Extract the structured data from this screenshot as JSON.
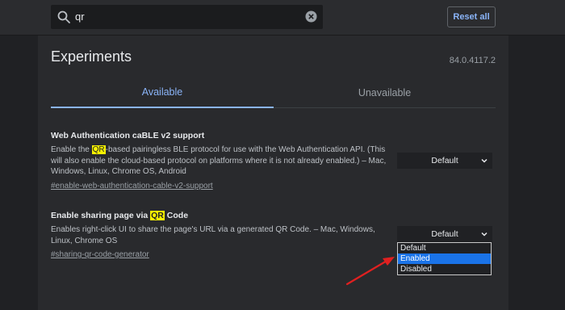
{
  "search": {
    "value": "qr",
    "reset_label": "Reset all"
  },
  "header": {
    "title": "Experiments",
    "version": "84.0.4117.2"
  },
  "tabs": [
    {
      "label": "Available",
      "active": true
    },
    {
      "label": "Unavailable",
      "active": false
    }
  ],
  "experiments": [
    {
      "title": "Web Authentication caBLE v2 support",
      "desc_before": "Enable the ",
      "highlight": "QR",
      "desc_after": "-based pairingless BLE protocol for use with the Web Authentication API. (This will also enable the cloud-based protocol on platforms where it is not already enabled.) – Mac, Windows, Linux, Chrome OS, Android",
      "link": "#enable-web-authentication-cable-v2-support",
      "select_value": "Default"
    },
    {
      "title_before": "Enable sharing page via ",
      "title_highlight": "QR",
      "title_after": " Code",
      "desc": "Enables right-click UI to share the page's URL via a generated QR Code. – Mac, Windows, Linux, Chrome OS",
      "link": "#sharing-qr-code-generator",
      "select_value": "Default"
    }
  ],
  "dropdown_options": [
    "Default",
    "Enabled",
    "Disabled"
  ],
  "dropdown_selected": "Enabled",
  "colors": {
    "accent": "#8ab4f8",
    "highlight": "#f9f200",
    "selection": "#1a73e8",
    "annotation_arrow": "#e02020"
  }
}
